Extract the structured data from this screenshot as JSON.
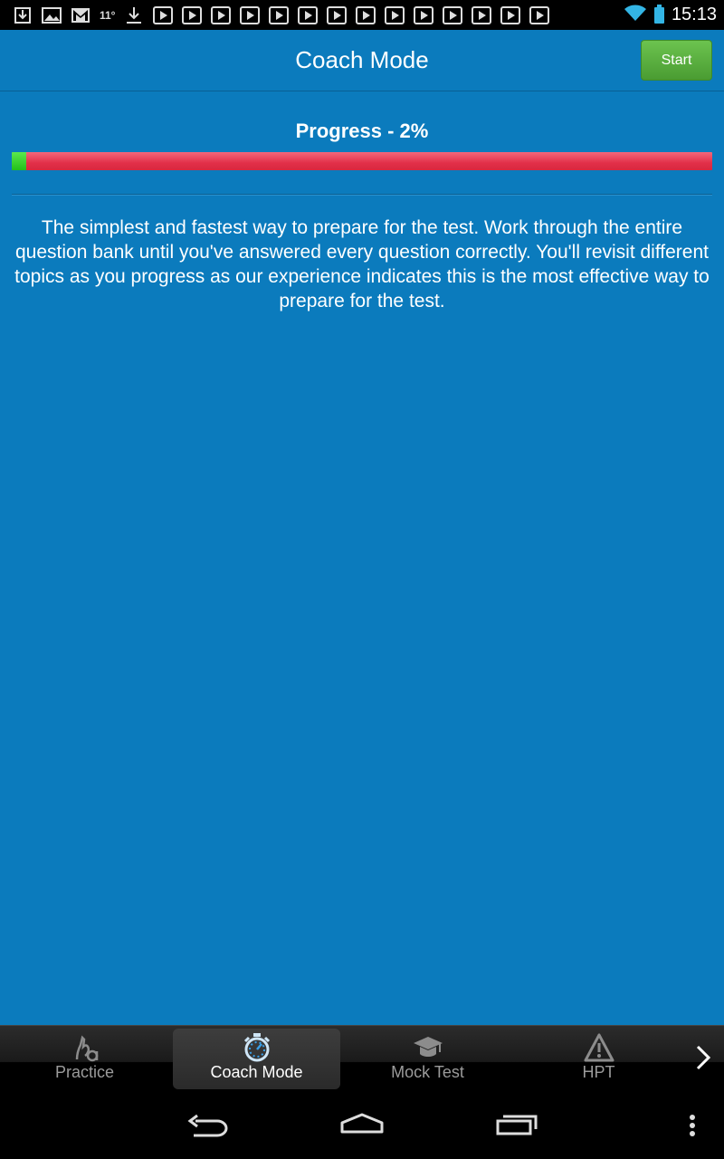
{
  "status_bar": {
    "temperature": "11°",
    "clock": "15:13"
  },
  "header": {
    "title": "Coach Mode",
    "start_label": "Start"
  },
  "progress": {
    "label": "Progress - 2%",
    "percent": 2,
    "fill_color": "#22c01a",
    "track_color": "#e23049"
  },
  "description": "The simplest and fastest way to prepare for the test. Work through the entire question bank until you've answered every question correctly. You'll revisit different topics as you progress as our experience indicates this is the most effective way to prepare for the test.",
  "tabs": [
    {
      "label": "Practice",
      "icon": "practice-icon",
      "active": false
    },
    {
      "label": "Coach Mode",
      "icon": "stopwatch-icon",
      "active": true
    },
    {
      "label": "Mock Test",
      "icon": "graduation-cap-icon",
      "active": false
    },
    {
      "label": "HPT",
      "icon": "warning-triangle-icon",
      "active": false
    }
  ],
  "colors": {
    "background": "#0b7bbd",
    "start_button": "#5cb13f",
    "accent": "#33b5e5"
  }
}
